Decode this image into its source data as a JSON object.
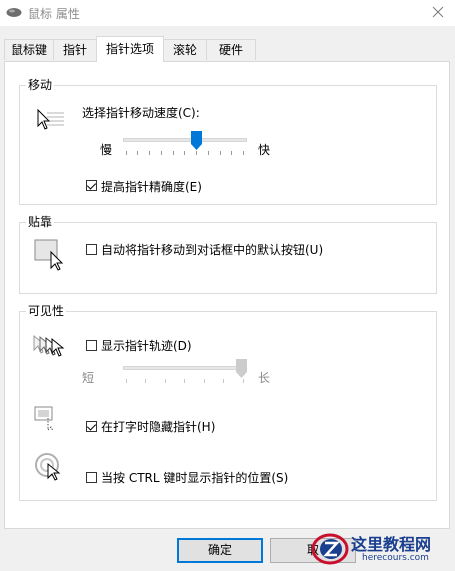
{
  "window": {
    "title": "鼠标 属性"
  },
  "tabs": [
    {
      "label": "鼠标键"
    },
    {
      "label": "指针"
    },
    {
      "label": "指针选项"
    },
    {
      "label": "滚轮"
    },
    {
      "label": "硬件"
    }
  ],
  "motion": {
    "title": "移动",
    "speed_label": "选择指针移动速度(C):",
    "slow_label": "慢",
    "fast_label": "快",
    "speed_value": 0.6,
    "enhance_precision_label": "提高指针精确度(E)",
    "enhance_precision_checked": true
  },
  "snap_to": {
    "title": "贴靠",
    "auto_move_label": "自动将指针移动到对话框中的默认按钮(U)",
    "auto_move_checked": false
  },
  "visibility": {
    "title": "可见性",
    "trails_label": "显示指针轨迹(D)",
    "trails_checked": false,
    "short_label": "短",
    "long_label": "长",
    "trails_value": 1.0,
    "hide_typing_label": "在打字时隐藏指针(H)",
    "hide_typing_checked": true,
    "show_ctrl_label": "当按 CTRL 键时显示指针的位置(S)",
    "show_ctrl_checked": false
  },
  "buttons": {
    "ok_label": "确定",
    "cancel_label": "取"
  },
  "watermark": {
    "cn": "这里教程网",
    "en": "herecours.com"
  },
  "colors": {
    "slider_thumb": "#0078d7",
    "window_bg": "#f0f0f0",
    "panel_bg": "#ffffff"
  },
  "icons": [
    "mouse-icon",
    "close-icon",
    "pointer-speed-icon",
    "snap-to-icon",
    "pointer-trails-icon",
    "hide-typing-icon",
    "ctrl-locate-icon"
  ]
}
